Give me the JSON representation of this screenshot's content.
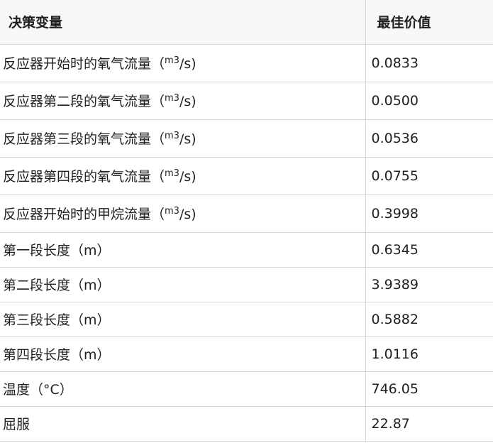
{
  "table": {
    "headers": {
      "variable": "决策变量",
      "value": "最佳价值"
    },
    "rows": [
      {
        "pre": "反应器开始时的氧气流量（",
        "sup": "m3",
        "post": "/s)",
        "value": "0.0833"
      },
      {
        "pre": "反应器第二段的氧气流量（",
        "sup": "m3",
        "post": "/s)",
        "value": "0.0500"
      },
      {
        "pre": "反应器第三段的氧气流量（",
        "sup": "m3",
        "post": "/s)",
        "value": "0.0536"
      },
      {
        "pre": "反应器第四段的氧气流量（",
        "sup": "m3",
        "post": "/s)",
        "value": "0.0755"
      },
      {
        "pre": "反应器开始时的甲烷流量（",
        "sup": "m3",
        "post": "/s)",
        "value": "0.3998"
      },
      {
        "pre": "第一段长度（m）",
        "sup": "",
        "post": "",
        "value": "0.6345"
      },
      {
        "pre": "第二段长度（m）",
        "sup": "",
        "post": "",
        "value": "3.9389"
      },
      {
        "pre": "第三段长度（m）",
        "sup": "",
        "post": "",
        "value": "0.5882"
      },
      {
        "pre": "第四段长度（m）",
        "sup": "",
        "post": "",
        "value": "1.0116"
      },
      {
        "pre": "温度（°C）",
        "sup": "",
        "post": "",
        "value": "746.05"
      },
      {
        "pre": "屈服",
        "sup": "",
        "post": "",
        "value": "22.87"
      }
    ]
  }
}
